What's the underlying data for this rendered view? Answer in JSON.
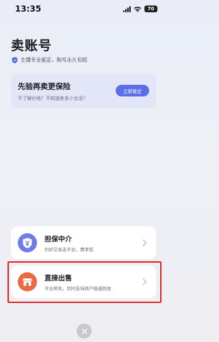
{
  "status_bar": {
    "time": "13:35",
    "battery": "70"
  },
  "header": {
    "title": "卖账号",
    "subtitle": "主播专业鉴定，购号永久包赔"
  },
  "promo": {
    "title": "先验再卖更保险",
    "subtitle": "不了解价格？不知道卖多少合适？",
    "button_label": "立即鉴定"
  },
  "options": [
    {
      "title": "担保中介",
      "description": "约好交易走平台，费率低"
    },
    {
      "title": "直接出售",
      "description": "平台帮卖，同时支持商户极速回收"
    }
  ],
  "colors": {
    "accent": "#5a6ee6",
    "escrow_icon": "#6f7ce8",
    "sell_icon": "#ea6a44",
    "highlight": "#e02424"
  },
  "icons": {
    "escrow": "yen-shield-icon",
    "sell": "shop-icon",
    "close": "close-icon"
  }
}
